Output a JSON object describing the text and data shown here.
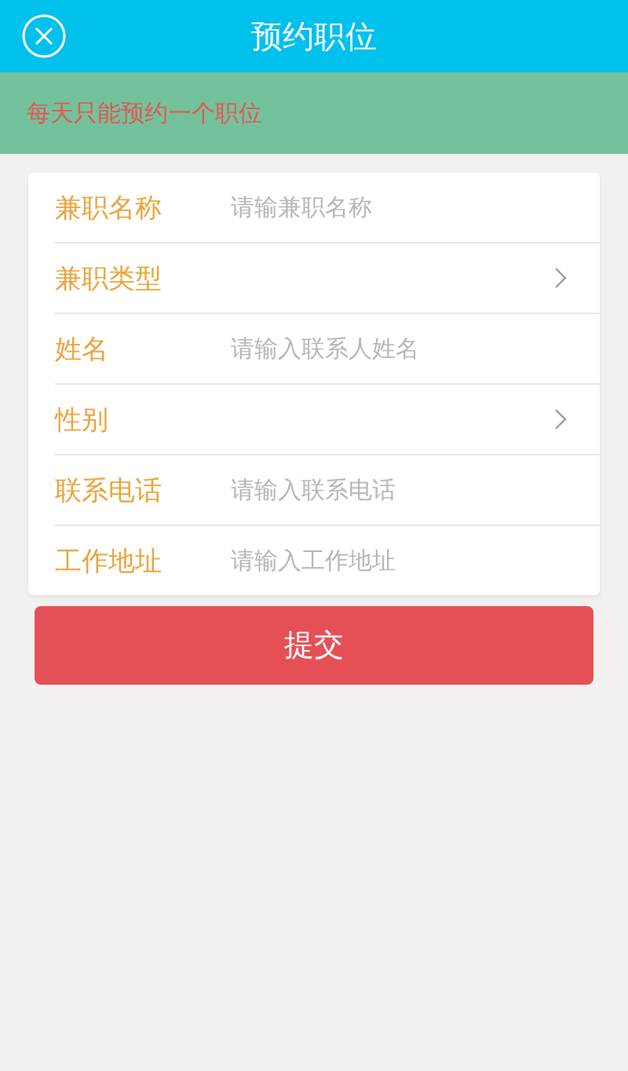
{
  "header": {
    "title": "预约职位"
  },
  "notice": "每天只能预约一个职位",
  "fields": [
    {
      "kind": "input",
      "label": "兼职名称",
      "placeholder": "请输兼职名称"
    },
    {
      "kind": "select",
      "label": "兼职类型"
    },
    {
      "kind": "input",
      "label": "姓名",
      "placeholder": "请输入联系人姓名"
    },
    {
      "kind": "select",
      "label": "性别"
    },
    {
      "kind": "input",
      "label": "联系电话",
      "placeholder": "请输入联系电话"
    },
    {
      "kind": "input",
      "label": "工作地址",
      "placeholder": "请输入工作地址"
    }
  ],
  "submit": "提交"
}
